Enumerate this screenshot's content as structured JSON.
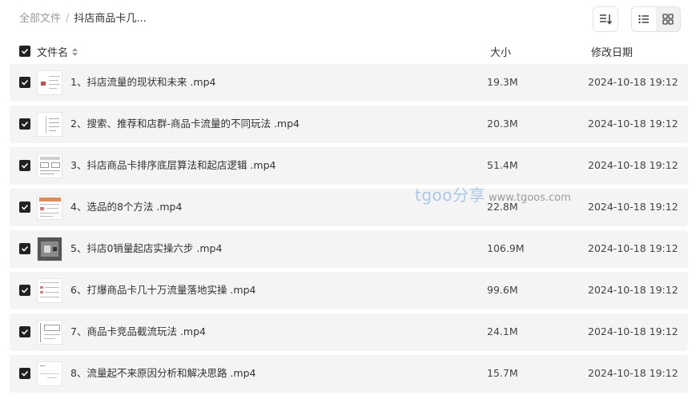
{
  "breadcrumb": {
    "root": "全部文件",
    "separator": "/",
    "current": "抖店商品卡几..."
  },
  "toolbar": {
    "sort_icon": "sort-icon",
    "list_view_icon": "list-view-icon",
    "grid_view_icon": "grid-view-icon"
  },
  "columns": {
    "name": "文件名",
    "size": "大小",
    "date": "修改日期"
  },
  "files": [
    {
      "name": "1、抖店流量的现状和未来 .mp4",
      "size": "19.3M",
      "date": "2024-10-18 19:12",
      "checked": true
    },
    {
      "name": "2、搜索、推荐和店群-商品卡流量的不同玩法 .mp4",
      "size": "20.3M",
      "date": "2024-10-18 19:12",
      "checked": true
    },
    {
      "name": "3、抖店商品卡排序底层算法和起店逻辑 .mp4",
      "size": "51.4M",
      "date": "2024-10-18 19:12",
      "checked": true
    },
    {
      "name": "4、选品的8个方法 .mp4",
      "size": "22.8M",
      "date": "2024-10-18 19:12",
      "checked": true
    },
    {
      "name": "5、抖店0销量起店实操六步 .mp4",
      "size": "106.9M",
      "date": "2024-10-18 19:12",
      "checked": true
    },
    {
      "name": "6、打爆商品卡几十万流量落地实操 .mp4",
      "size": "99.6M",
      "date": "2024-10-18 19:12",
      "checked": true
    },
    {
      "name": "7、商品卡竞品截流玩法 .mp4",
      "size": "24.1M",
      "date": "2024-10-18 19:12",
      "checked": true
    },
    {
      "name": "8、流量起不来原因分析和解决思路 .mp4",
      "size": "15.7M",
      "date": "2024-10-18 19:12",
      "checked": true
    }
  ],
  "watermark": {
    "brand": "tgoo分享",
    "url": "www.tgoos.com"
  },
  "colors": {
    "row_background": "#f4f4f4",
    "checkbox": "#222222",
    "watermark_brand": "#a9c9ea"
  }
}
